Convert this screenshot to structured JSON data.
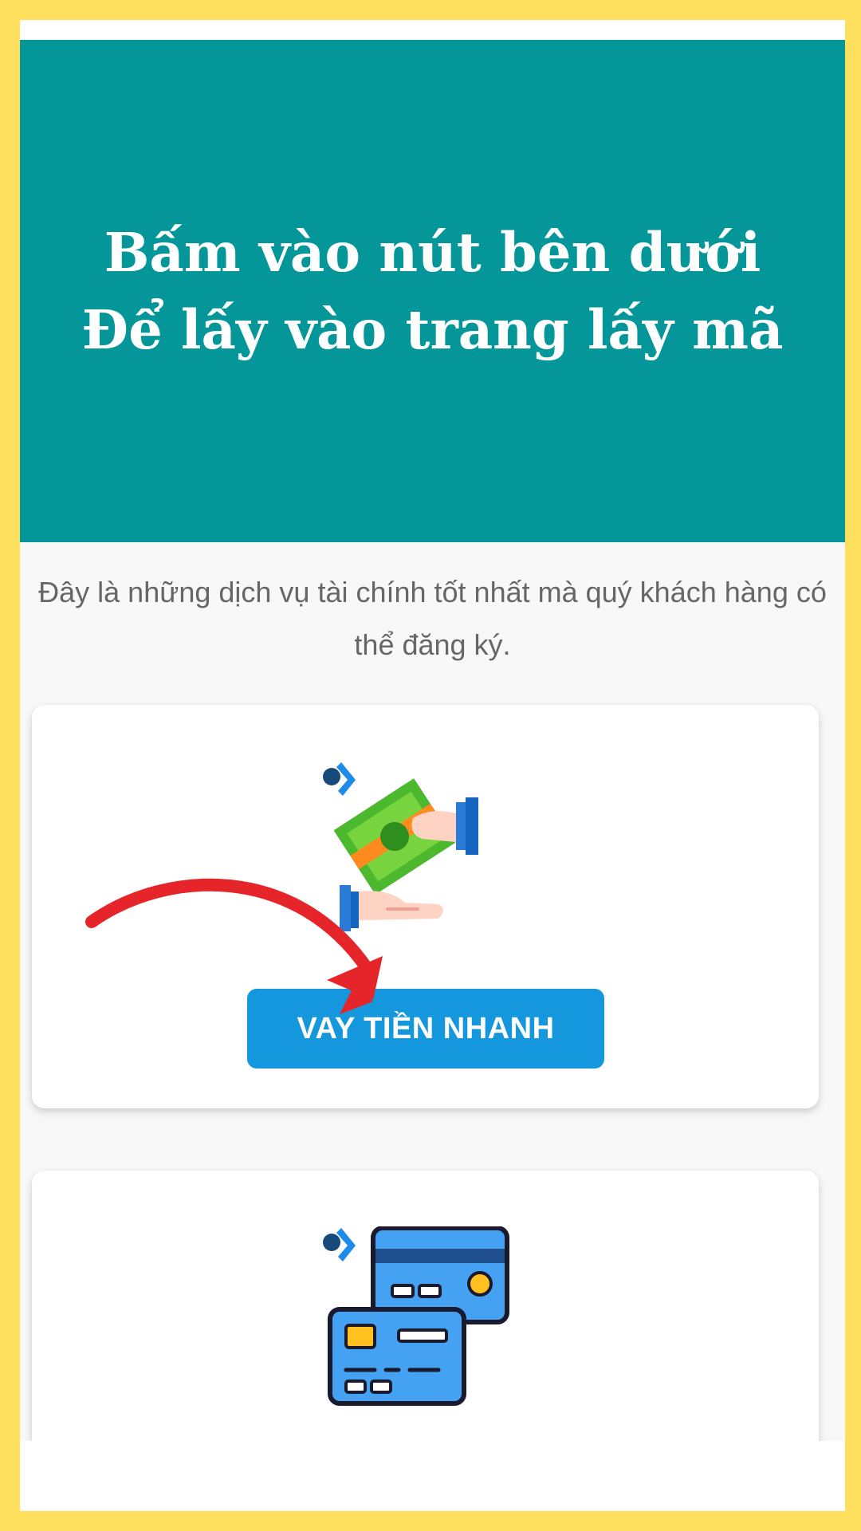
{
  "banner": {
    "line1": "Bấm vào nút bên dưới",
    "line2": "Để lấy vào trang lấy mã"
  },
  "intro": {
    "text": "Đây là những dịch vụ tài chính tốt nhất mà quý khách hàng có thể đăng ký."
  },
  "services": {
    "loan": {
      "button_label": "VAY TIỀN NHANH",
      "icon": "money-hand-icon"
    },
    "card": {
      "icon": "credit-card-icon"
    }
  },
  "colors": {
    "frame": "#FFDF5E",
    "banner": "#05969A",
    "button": "#1497DC",
    "arrow": "#E5252A"
  }
}
